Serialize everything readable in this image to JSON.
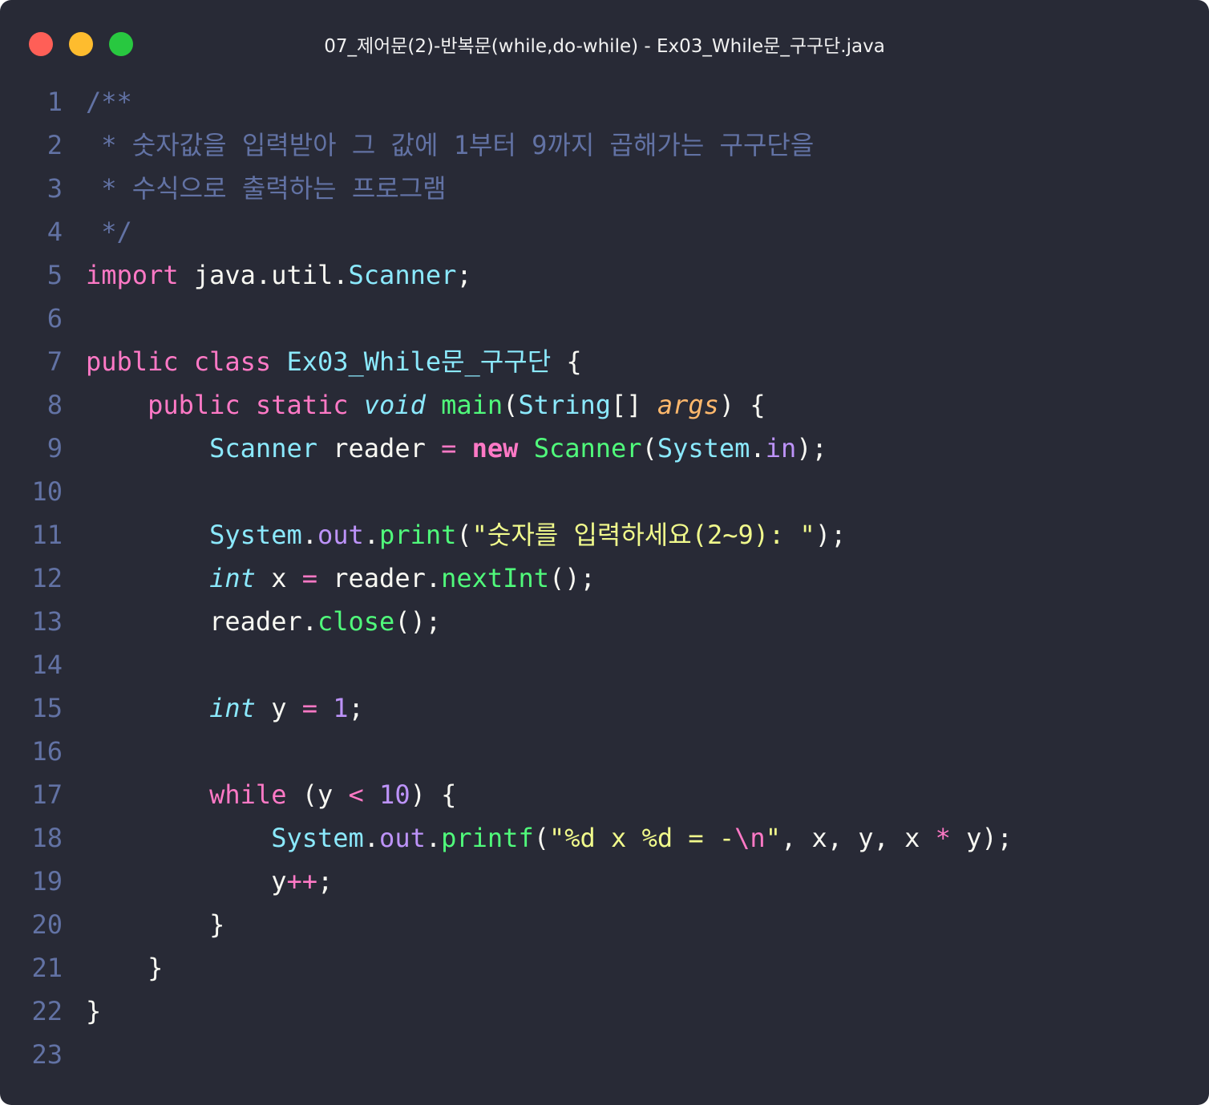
{
  "window": {
    "title": "07_제어문(2)-반복문(while,do-while) - Ex03_While문_구구단.java",
    "controls": {
      "close_color": "#ff5f57",
      "minimize_color": "#febc2e",
      "maximize_color": "#28c840"
    }
  },
  "theme": {
    "background": "#282a36",
    "foreground": "#f8f8f2",
    "comment": "#6272a4",
    "keyword": "#ff79c6",
    "type": "#8be9fd",
    "function": "#50fa7b",
    "string": "#f1fa8c",
    "number": "#bd93f9",
    "parameter": "#ffb86c"
  },
  "code_lines": [
    {
      "n": "1",
      "tokens": [
        [
          "cm",
          "/**"
        ]
      ]
    },
    {
      "n": "2",
      "tokens": [
        [
          "cm",
          " * 숫자값을 입력받아 그 값에 1부터 9까지 곱해가는 구구단을"
        ]
      ]
    },
    {
      "n": "3",
      "tokens": [
        [
          "cm",
          " * 수식으로 출력하는 프로그램"
        ]
      ]
    },
    {
      "n": "4",
      "tokens": [
        [
          "cm",
          " */"
        ]
      ]
    },
    {
      "n": "5",
      "tokens": [
        [
          "kw",
          "import"
        ],
        [
          "pl",
          " java.util."
        ],
        [
          "ty",
          "Scanner"
        ],
        [
          "pl",
          ";"
        ]
      ]
    },
    {
      "n": "6",
      "tokens": []
    },
    {
      "n": "7",
      "tokens": [
        [
          "kw",
          "public"
        ],
        [
          "pl",
          " "
        ],
        [
          "kw",
          "class"
        ],
        [
          "pl",
          " "
        ],
        [
          "ty",
          "Ex03_While문_구구단"
        ],
        [
          "pl",
          " {"
        ]
      ]
    },
    {
      "n": "8",
      "tokens": [
        [
          "pl",
          "    "
        ],
        [
          "kw",
          "public"
        ],
        [
          "pl",
          " "
        ],
        [
          "kw",
          "static"
        ],
        [
          "pl",
          " "
        ],
        [
          "tyi",
          "void"
        ],
        [
          "pl",
          " "
        ],
        [
          "fn",
          "main"
        ],
        [
          "pl",
          "("
        ],
        [
          "ty",
          "String"
        ],
        [
          "pl",
          "[] "
        ],
        [
          "par",
          "args"
        ],
        [
          "pl",
          ") {"
        ]
      ]
    },
    {
      "n": "9",
      "tokens": [
        [
          "pl",
          "        "
        ],
        [
          "ty",
          "Scanner"
        ],
        [
          "pl",
          " reader "
        ],
        [
          "op",
          "="
        ],
        [
          "pl",
          " "
        ],
        [
          "kwb",
          "new"
        ],
        [
          "pl",
          " "
        ],
        [
          "fn",
          "Scanner"
        ],
        [
          "pl",
          "("
        ],
        [
          "ty",
          "System"
        ],
        [
          "pl",
          "."
        ],
        [
          "fld",
          "in"
        ],
        [
          "pl",
          ");"
        ]
      ]
    },
    {
      "n": "10",
      "tokens": []
    },
    {
      "n": "11",
      "tokens": [
        [
          "pl",
          "        "
        ],
        [
          "ty",
          "System"
        ],
        [
          "pl",
          "."
        ],
        [
          "fld",
          "out"
        ],
        [
          "pl",
          "."
        ],
        [
          "fn",
          "print"
        ],
        [
          "pl",
          "("
        ],
        [
          "str",
          "\"숫자를 입력하세요(2~9): \""
        ],
        [
          "pl",
          ");"
        ]
      ]
    },
    {
      "n": "12",
      "tokens": [
        [
          "pl",
          "        "
        ],
        [
          "tyi",
          "int"
        ],
        [
          "pl",
          " x "
        ],
        [
          "op",
          "="
        ],
        [
          "pl",
          " reader."
        ],
        [
          "fn",
          "nextInt"
        ],
        [
          "pl",
          "();"
        ]
      ]
    },
    {
      "n": "13",
      "tokens": [
        [
          "pl",
          "        reader."
        ],
        [
          "fn",
          "close"
        ],
        [
          "pl",
          "();"
        ]
      ]
    },
    {
      "n": "14",
      "tokens": []
    },
    {
      "n": "15",
      "tokens": [
        [
          "pl",
          "        "
        ],
        [
          "tyi",
          "int"
        ],
        [
          "pl",
          " y "
        ],
        [
          "op",
          "="
        ],
        [
          "pl",
          " "
        ],
        [
          "num",
          "1"
        ],
        [
          "pl",
          ";"
        ]
      ]
    },
    {
      "n": "16",
      "tokens": []
    },
    {
      "n": "17",
      "tokens": [
        [
          "pl",
          "        "
        ],
        [
          "kw",
          "while"
        ],
        [
          "pl",
          " (y "
        ],
        [
          "op",
          "<"
        ],
        [
          "pl",
          " "
        ],
        [
          "num",
          "10"
        ],
        [
          "pl",
          ") {"
        ]
      ]
    },
    {
      "n": "18",
      "tokens": [
        [
          "pl",
          "            "
        ],
        [
          "ty",
          "System"
        ],
        [
          "pl",
          "."
        ],
        [
          "fld",
          "out"
        ],
        [
          "pl",
          "."
        ],
        [
          "fn",
          "printf"
        ],
        [
          "pl",
          "("
        ],
        [
          "str",
          "\"%d x %d = -"
        ],
        [
          "kw",
          "\\n"
        ],
        [
          "str",
          "\""
        ],
        [
          "pl",
          ", x, y, x "
        ],
        [
          "op",
          "*"
        ],
        [
          "pl",
          " y);"
        ]
      ]
    },
    {
      "n": "19",
      "tokens": [
        [
          "pl",
          "            y"
        ],
        [
          "op",
          "++"
        ],
        [
          "pl",
          ";"
        ]
      ]
    },
    {
      "n": "20",
      "tokens": [
        [
          "pl",
          "        }"
        ]
      ]
    },
    {
      "n": "21",
      "tokens": [
        [
          "pl",
          "    }"
        ]
      ]
    },
    {
      "n": "22",
      "tokens": [
        [
          "pl",
          "}"
        ]
      ]
    },
    {
      "n": "23",
      "tokens": []
    }
  ]
}
